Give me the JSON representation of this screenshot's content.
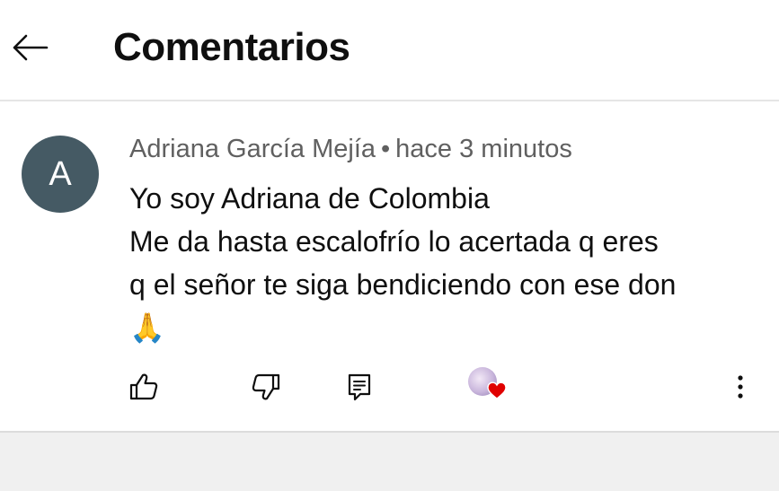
{
  "header": {
    "title": "Comentarios",
    "back_icon": "arrow-left-icon"
  },
  "comment": {
    "avatar_letter": "A",
    "avatar_color": "#455a64",
    "author": "Adriana García Mejía",
    "separator": "•",
    "time": "hace 3 minutos",
    "lines": [
      "Yo soy Adriana de Colombia",
      "Me da hasta escalofrío lo acertada q eres",
      "q el señor te siga bendiciendo con ese don",
      "🙏"
    ],
    "actions": {
      "like_icon": "thumbs-up-icon",
      "dislike_icon": "thumbs-down-icon",
      "reply_icon": "reply-icon",
      "creator_heart_icon": "heart-icon",
      "more_icon": "more-vertical-icon"
    }
  }
}
